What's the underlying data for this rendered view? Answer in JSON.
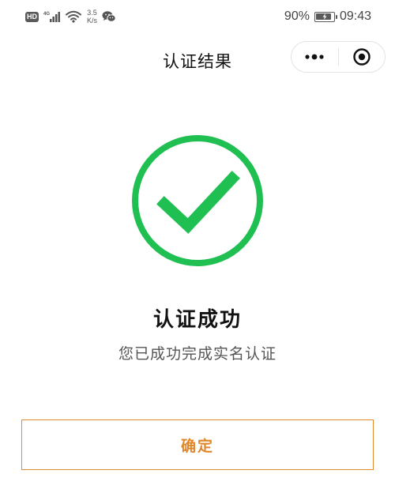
{
  "status_bar": {
    "hd_label": "HD",
    "network_type": "4G",
    "net_speed_value": "3.5",
    "net_speed_unit": "K/s",
    "battery_percent": "90%",
    "battery_level": 0.9,
    "time": "09:43",
    "icons": [
      "signal-icon",
      "wifi-icon",
      "wechat-icon",
      "battery-icon"
    ]
  },
  "nav": {
    "title": "认证结果",
    "icons": [
      "more-dots-icon",
      "close-target-icon"
    ]
  },
  "result": {
    "icon": "check-circle-icon",
    "title": "认证成功",
    "description": "您已成功完成实名认证"
  },
  "confirm_button": {
    "label": "确定"
  },
  "colors": {
    "success_green": "#1fbf52",
    "accent_orange": "#e0862b",
    "title_text": "#111111",
    "desc_text": "#555555"
  }
}
